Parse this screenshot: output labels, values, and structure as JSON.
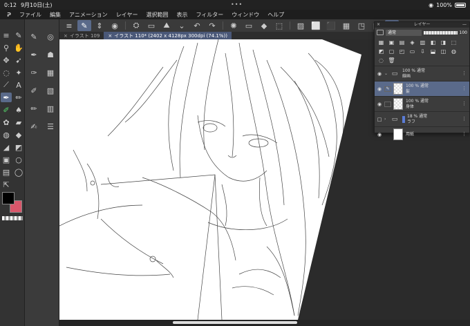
{
  "status": {
    "time": "0:12",
    "date": "9月10日(土)",
    "battery": "100%",
    "dots": "•••"
  },
  "menu": {
    "logo": "ᕈ",
    "items": [
      "ファイル",
      "編集",
      "アニメーション",
      "レイヤー",
      "選択範囲",
      "表示",
      "フィルター",
      "ウィンドウ",
      "ヘルプ"
    ]
  },
  "tabs": [
    {
      "label": "イラスト 109",
      "close": "×",
      "active": false
    },
    {
      "label": "イラスト 110* (2402 x 4128px 300dpi (74.1%))",
      "close": "×",
      "active": true
    }
  ],
  "layer_panel": {
    "title": "レイヤー",
    "close": "×",
    "minimize": "—",
    "blend_mode": "通常",
    "opacity": "100",
    "layers": [
      {
        "percent": "100 %",
        "mode": "通常",
        "name": "線画",
        "kind": "folder",
        "expanded": true
      },
      {
        "percent": "100 %",
        "mode": "通常",
        "name": "髪",
        "kind": "raster",
        "selected": true
      },
      {
        "percent": "100 %",
        "mode": "通常",
        "name": "身体",
        "kind": "raster"
      },
      {
        "percent": "18 %",
        "mode": "通常",
        "name": "ラフ",
        "kind": "folder",
        "expanded": false
      },
      {
        "percent": "",
        "mode": "",
        "name": "用紙",
        "kind": "paper"
      }
    ]
  },
  "colors": {
    "main": "#000000",
    "sub": "#d9566a",
    "accent": "#5a6a8a"
  }
}
